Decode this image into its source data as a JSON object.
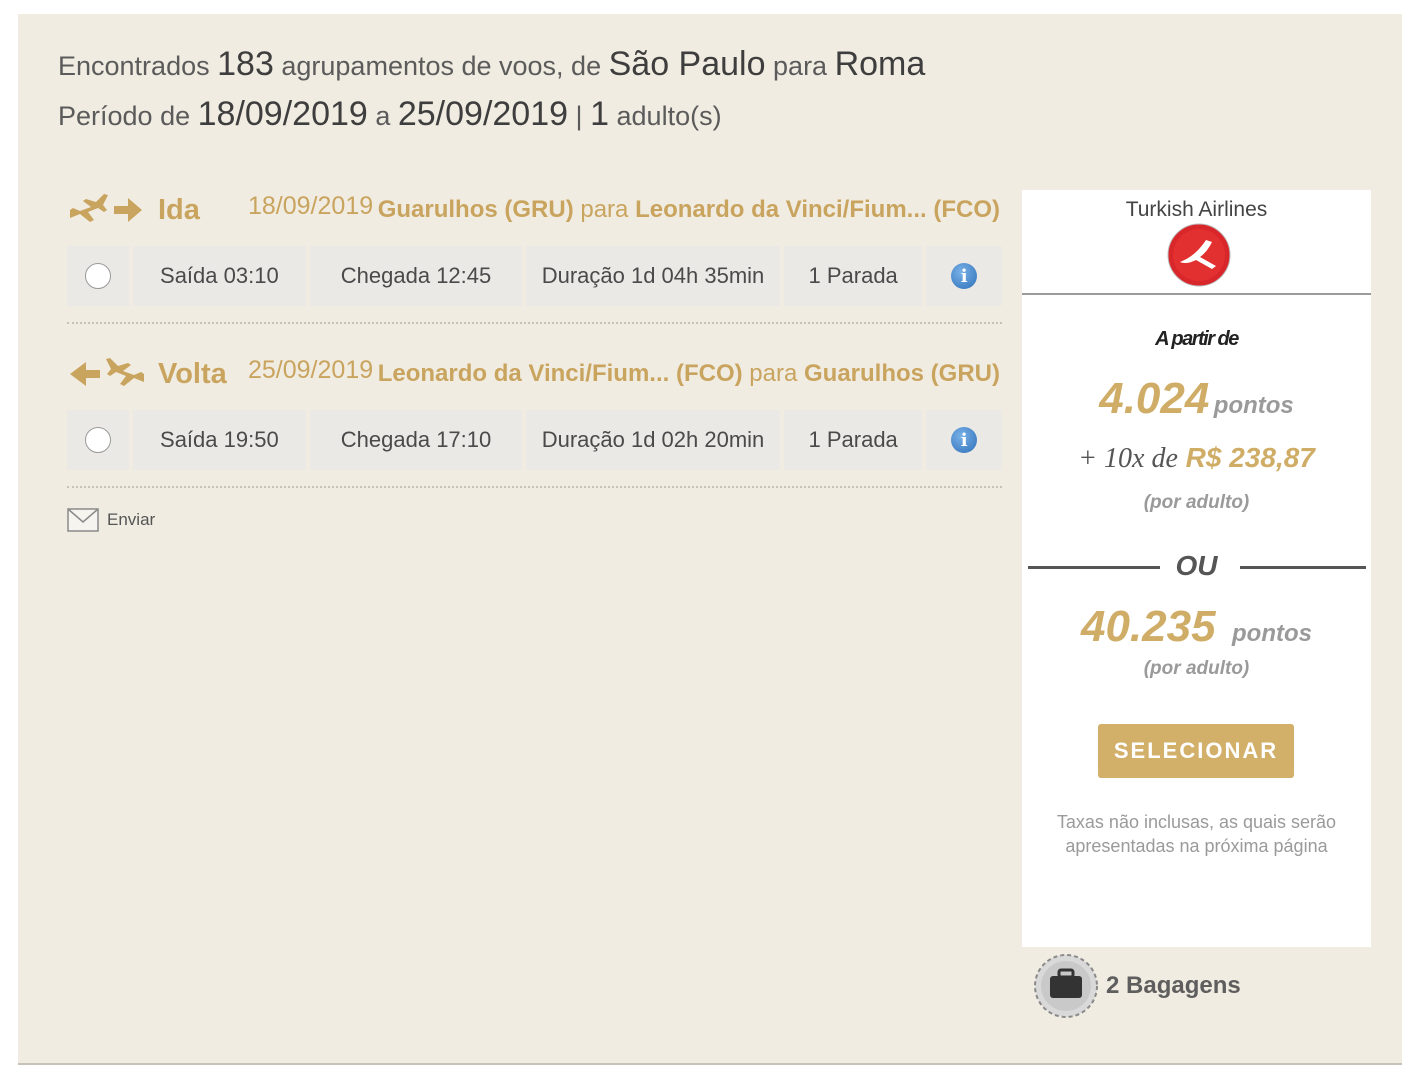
{
  "summary": {
    "line1": {
      "prefix": "Encontrados",
      "count": "183",
      "mid": "agrupamentos de voos, de",
      "origin": "São Paulo",
      "para": "para",
      "destination": "Roma"
    },
    "line2": {
      "prefix": "Período de",
      "date_from": "18/09/2019",
      "a": "a",
      "date_to": "25/09/2019",
      "sep": "|",
      "adults": "1",
      "adults_label": "adulto(s)"
    }
  },
  "outbound": {
    "label": "Ida",
    "date": "18/09/2019",
    "from": "Guarulhos (GRU)",
    "para": "para",
    "to": "Leonardo da Vinci/Fium... (FCO)",
    "departure": "Saída 03:10",
    "arrival": "Chegada 12:45",
    "duration": "Duração 1d 04h 35min",
    "stops": "1 Parada"
  },
  "inbound": {
    "label": "Volta",
    "date": "25/09/2019",
    "from": "Leonardo da Vinci/Fium... (FCO)",
    "para": "para",
    "to": "Guarulhos (GRU)",
    "departure": "Saída 19:50",
    "arrival": "Chegada 17:10",
    "duration": "Duração 1d 02h 20min",
    "stops": "1 Parada"
  },
  "send_label": "Enviar",
  "offer": {
    "airline": "Turkish Airlines",
    "from_label": "A partir de",
    "points_1": "4.024",
    "points_label": "pontos",
    "installment_prefix": "+ 10x de",
    "installment_amount": "R$ 238,87",
    "per_adult": "(por adulto)",
    "or_label": "OU",
    "points_2": "40.235",
    "select_button": "SELECIONAR",
    "tax_note_1": "Taxas não inclusas, as quais serão",
    "tax_note_2": "apresentadas na próxima página"
  },
  "baggage": "2 Bagagens",
  "colors": {
    "gold": "#c9a45f",
    "button": "#d3b06a",
    "panel_bg": "#f1ece1",
    "brand_red": "#d9262b"
  },
  "icons": [
    "plane-right-icon",
    "arrow-right-icon",
    "arrow-left-icon",
    "plane-left-icon",
    "info-icon",
    "envelope-icon",
    "turkish-airlines-logo",
    "suitcase-icon"
  ]
}
